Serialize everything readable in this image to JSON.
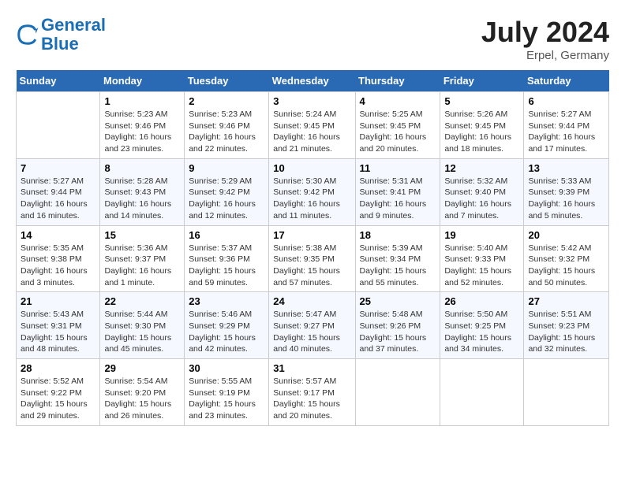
{
  "header": {
    "logo_line1": "General",
    "logo_line2": "Blue",
    "month_year": "July 2024",
    "location": "Erpel, Germany"
  },
  "weekdays": [
    "Sunday",
    "Monday",
    "Tuesday",
    "Wednesday",
    "Thursday",
    "Friday",
    "Saturday"
  ],
  "weeks": [
    [
      {
        "day": "",
        "info": ""
      },
      {
        "day": "1",
        "info": "Sunrise: 5:23 AM\nSunset: 9:46 PM\nDaylight: 16 hours\nand 23 minutes."
      },
      {
        "day": "2",
        "info": "Sunrise: 5:23 AM\nSunset: 9:46 PM\nDaylight: 16 hours\nand 22 minutes."
      },
      {
        "day": "3",
        "info": "Sunrise: 5:24 AM\nSunset: 9:45 PM\nDaylight: 16 hours\nand 21 minutes."
      },
      {
        "day": "4",
        "info": "Sunrise: 5:25 AM\nSunset: 9:45 PM\nDaylight: 16 hours\nand 20 minutes."
      },
      {
        "day": "5",
        "info": "Sunrise: 5:26 AM\nSunset: 9:45 PM\nDaylight: 16 hours\nand 18 minutes."
      },
      {
        "day": "6",
        "info": "Sunrise: 5:27 AM\nSunset: 9:44 PM\nDaylight: 16 hours\nand 17 minutes."
      }
    ],
    [
      {
        "day": "7",
        "info": "Sunrise: 5:27 AM\nSunset: 9:44 PM\nDaylight: 16 hours\nand 16 minutes."
      },
      {
        "day": "8",
        "info": "Sunrise: 5:28 AM\nSunset: 9:43 PM\nDaylight: 16 hours\nand 14 minutes."
      },
      {
        "day": "9",
        "info": "Sunrise: 5:29 AM\nSunset: 9:42 PM\nDaylight: 16 hours\nand 12 minutes."
      },
      {
        "day": "10",
        "info": "Sunrise: 5:30 AM\nSunset: 9:42 PM\nDaylight: 16 hours\nand 11 minutes."
      },
      {
        "day": "11",
        "info": "Sunrise: 5:31 AM\nSunset: 9:41 PM\nDaylight: 16 hours\nand 9 minutes."
      },
      {
        "day": "12",
        "info": "Sunrise: 5:32 AM\nSunset: 9:40 PM\nDaylight: 16 hours\nand 7 minutes."
      },
      {
        "day": "13",
        "info": "Sunrise: 5:33 AM\nSunset: 9:39 PM\nDaylight: 16 hours\nand 5 minutes."
      }
    ],
    [
      {
        "day": "14",
        "info": "Sunrise: 5:35 AM\nSunset: 9:38 PM\nDaylight: 16 hours\nand 3 minutes."
      },
      {
        "day": "15",
        "info": "Sunrise: 5:36 AM\nSunset: 9:37 PM\nDaylight: 16 hours\nand 1 minute."
      },
      {
        "day": "16",
        "info": "Sunrise: 5:37 AM\nSunset: 9:36 PM\nDaylight: 15 hours\nand 59 minutes."
      },
      {
        "day": "17",
        "info": "Sunrise: 5:38 AM\nSunset: 9:35 PM\nDaylight: 15 hours\nand 57 minutes."
      },
      {
        "day": "18",
        "info": "Sunrise: 5:39 AM\nSunset: 9:34 PM\nDaylight: 15 hours\nand 55 minutes."
      },
      {
        "day": "19",
        "info": "Sunrise: 5:40 AM\nSunset: 9:33 PM\nDaylight: 15 hours\nand 52 minutes."
      },
      {
        "day": "20",
        "info": "Sunrise: 5:42 AM\nSunset: 9:32 PM\nDaylight: 15 hours\nand 50 minutes."
      }
    ],
    [
      {
        "day": "21",
        "info": "Sunrise: 5:43 AM\nSunset: 9:31 PM\nDaylight: 15 hours\nand 48 minutes."
      },
      {
        "day": "22",
        "info": "Sunrise: 5:44 AM\nSunset: 9:30 PM\nDaylight: 15 hours\nand 45 minutes."
      },
      {
        "day": "23",
        "info": "Sunrise: 5:46 AM\nSunset: 9:29 PM\nDaylight: 15 hours\nand 42 minutes."
      },
      {
        "day": "24",
        "info": "Sunrise: 5:47 AM\nSunset: 9:27 PM\nDaylight: 15 hours\nand 40 minutes."
      },
      {
        "day": "25",
        "info": "Sunrise: 5:48 AM\nSunset: 9:26 PM\nDaylight: 15 hours\nand 37 minutes."
      },
      {
        "day": "26",
        "info": "Sunrise: 5:50 AM\nSunset: 9:25 PM\nDaylight: 15 hours\nand 34 minutes."
      },
      {
        "day": "27",
        "info": "Sunrise: 5:51 AM\nSunset: 9:23 PM\nDaylight: 15 hours\nand 32 minutes."
      }
    ],
    [
      {
        "day": "28",
        "info": "Sunrise: 5:52 AM\nSunset: 9:22 PM\nDaylight: 15 hours\nand 29 minutes."
      },
      {
        "day": "29",
        "info": "Sunrise: 5:54 AM\nSunset: 9:20 PM\nDaylight: 15 hours\nand 26 minutes."
      },
      {
        "day": "30",
        "info": "Sunrise: 5:55 AM\nSunset: 9:19 PM\nDaylight: 15 hours\nand 23 minutes."
      },
      {
        "day": "31",
        "info": "Sunrise: 5:57 AM\nSunset: 9:17 PM\nDaylight: 15 hours\nand 20 minutes."
      },
      {
        "day": "",
        "info": ""
      },
      {
        "day": "",
        "info": ""
      },
      {
        "day": "",
        "info": ""
      }
    ]
  ]
}
